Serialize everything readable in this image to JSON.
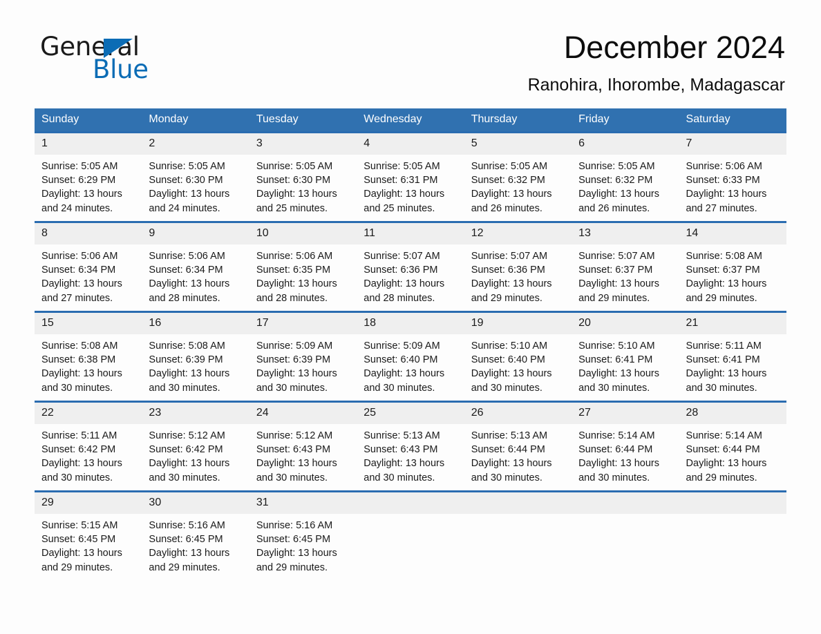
{
  "logo": {
    "word_one": "General",
    "word_two": "Blue",
    "triangle_color": "#0b6cb5"
  },
  "header": {
    "title": "December 2024",
    "subtitle": "Ranohira, Ihorombe, Madagascar"
  },
  "theme": {
    "header_blue": "#3071b0",
    "row_rule_blue": "#2a6cb0",
    "daynum_band": "#efefef",
    "page_background": "#fdfdfd"
  },
  "weekday_headers": [
    "Sunday",
    "Monday",
    "Tuesday",
    "Wednesday",
    "Thursday",
    "Friday",
    "Saturday"
  ],
  "weeks": [
    [
      {
        "day": "1",
        "sunrise": "Sunrise: 5:05 AM",
        "sunset": "Sunset: 6:29 PM",
        "daylight": "Daylight: 13 hours and 24 minutes."
      },
      {
        "day": "2",
        "sunrise": "Sunrise: 5:05 AM",
        "sunset": "Sunset: 6:30 PM",
        "daylight": "Daylight: 13 hours and 24 minutes."
      },
      {
        "day": "3",
        "sunrise": "Sunrise: 5:05 AM",
        "sunset": "Sunset: 6:30 PM",
        "daylight": "Daylight: 13 hours and 25 minutes."
      },
      {
        "day": "4",
        "sunrise": "Sunrise: 5:05 AM",
        "sunset": "Sunset: 6:31 PM",
        "daylight": "Daylight: 13 hours and 25 minutes."
      },
      {
        "day": "5",
        "sunrise": "Sunrise: 5:05 AM",
        "sunset": "Sunset: 6:32 PM",
        "daylight": "Daylight: 13 hours and 26 minutes."
      },
      {
        "day": "6",
        "sunrise": "Sunrise: 5:05 AM",
        "sunset": "Sunset: 6:32 PM",
        "daylight": "Daylight: 13 hours and 26 minutes."
      },
      {
        "day": "7",
        "sunrise": "Sunrise: 5:06 AM",
        "sunset": "Sunset: 6:33 PM",
        "daylight": "Daylight: 13 hours and 27 minutes."
      }
    ],
    [
      {
        "day": "8",
        "sunrise": "Sunrise: 5:06 AM",
        "sunset": "Sunset: 6:34 PM",
        "daylight": "Daylight: 13 hours and 27 minutes."
      },
      {
        "day": "9",
        "sunrise": "Sunrise: 5:06 AM",
        "sunset": "Sunset: 6:34 PM",
        "daylight": "Daylight: 13 hours and 28 minutes."
      },
      {
        "day": "10",
        "sunrise": "Sunrise: 5:06 AM",
        "sunset": "Sunset: 6:35 PM",
        "daylight": "Daylight: 13 hours and 28 minutes."
      },
      {
        "day": "11",
        "sunrise": "Sunrise: 5:07 AM",
        "sunset": "Sunset: 6:36 PM",
        "daylight": "Daylight: 13 hours and 28 minutes."
      },
      {
        "day": "12",
        "sunrise": "Sunrise: 5:07 AM",
        "sunset": "Sunset: 6:36 PM",
        "daylight": "Daylight: 13 hours and 29 minutes."
      },
      {
        "day": "13",
        "sunrise": "Sunrise: 5:07 AM",
        "sunset": "Sunset: 6:37 PM",
        "daylight": "Daylight: 13 hours and 29 minutes."
      },
      {
        "day": "14",
        "sunrise": "Sunrise: 5:08 AM",
        "sunset": "Sunset: 6:37 PM",
        "daylight": "Daylight: 13 hours and 29 minutes."
      }
    ],
    [
      {
        "day": "15",
        "sunrise": "Sunrise: 5:08 AM",
        "sunset": "Sunset: 6:38 PM",
        "daylight": "Daylight: 13 hours and 30 minutes."
      },
      {
        "day": "16",
        "sunrise": "Sunrise: 5:08 AM",
        "sunset": "Sunset: 6:39 PM",
        "daylight": "Daylight: 13 hours and 30 minutes."
      },
      {
        "day": "17",
        "sunrise": "Sunrise: 5:09 AM",
        "sunset": "Sunset: 6:39 PM",
        "daylight": "Daylight: 13 hours and 30 minutes."
      },
      {
        "day": "18",
        "sunrise": "Sunrise: 5:09 AM",
        "sunset": "Sunset: 6:40 PM",
        "daylight": "Daylight: 13 hours and 30 minutes."
      },
      {
        "day": "19",
        "sunrise": "Sunrise: 5:10 AM",
        "sunset": "Sunset: 6:40 PM",
        "daylight": "Daylight: 13 hours and 30 minutes."
      },
      {
        "day": "20",
        "sunrise": "Sunrise: 5:10 AM",
        "sunset": "Sunset: 6:41 PM",
        "daylight": "Daylight: 13 hours and 30 minutes."
      },
      {
        "day": "21",
        "sunrise": "Sunrise: 5:11 AM",
        "sunset": "Sunset: 6:41 PM",
        "daylight": "Daylight: 13 hours and 30 minutes."
      }
    ],
    [
      {
        "day": "22",
        "sunrise": "Sunrise: 5:11 AM",
        "sunset": "Sunset: 6:42 PM",
        "daylight": "Daylight: 13 hours and 30 minutes."
      },
      {
        "day": "23",
        "sunrise": "Sunrise: 5:12 AM",
        "sunset": "Sunset: 6:42 PM",
        "daylight": "Daylight: 13 hours and 30 minutes."
      },
      {
        "day": "24",
        "sunrise": "Sunrise: 5:12 AM",
        "sunset": "Sunset: 6:43 PM",
        "daylight": "Daylight: 13 hours and 30 minutes."
      },
      {
        "day": "25",
        "sunrise": "Sunrise: 5:13 AM",
        "sunset": "Sunset: 6:43 PM",
        "daylight": "Daylight: 13 hours and 30 minutes."
      },
      {
        "day": "26",
        "sunrise": "Sunrise: 5:13 AM",
        "sunset": "Sunset: 6:44 PM",
        "daylight": "Daylight: 13 hours and 30 minutes."
      },
      {
        "day": "27",
        "sunrise": "Sunrise: 5:14 AM",
        "sunset": "Sunset: 6:44 PM",
        "daylight": "Daylight: 13 hours and 30 minutes."
      },
      {
        "day": "28",
        "sunrise": "Sunrise: 5:14 AM",
        "sunset": "Sunset: 6:44 PM",
        "daylight": "Daylight: 13 hours and 29 minutes."
      }
    ],
    [
      {
        "day": "29",
        "sunrise": "Sunrise: 5:15 AM",
        "sunset": "Sunset: 6:45 PM",
        "daylight": "Daylight: 13 hours and 29 minutes."
      },
      {
        "day": "30",
        "sunrise": "Sunrise: 5:16 AM",
        "sunset": "Sunset: 6:45 PM",
        "daylight": "Daylight: 13 hours and 29 minutes."
      },
      {
        "day": "31",
        "sunrise": "Sunrise: 5:16 AM",
        "sunset": "Sunset: 6:45 PM",
        "daylight": "Daylight: 13 hours and 29 minutes."
      },
      {
        "day": "",
        "sunrise": "",
        "sunset": "",
        "daylight": ""
      },
      {
        "day": "",
        "sunrise": "",
        "sunset": "",
        "daylight": ""
      },
      {
        "day": "",
        "sunrise": "",
        "sunset": "",
        "daylight": ""
      },
      {
        "day": "",
        "sunrise": "",
        "sunset": "",
        "daylight": ""
      }
    ]
  ]
}
